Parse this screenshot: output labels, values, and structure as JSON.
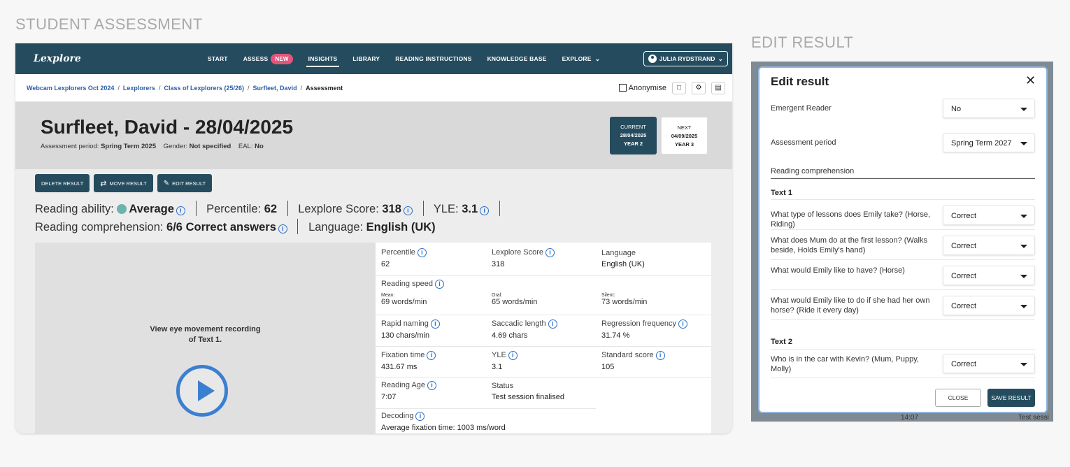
{
  "section_titles": {
    "left": "STUDENT ASSESSMENT",
    "right": "EDIT RESULT"
  },
  "app": {
    "logo": "Lexplore",
    "nav": [
      {
        "label": "START"
      },
      {
        "label": "ASSESS",
        "badge": "NEW"
      },
      {
        "label": "INSIGHTS",
        "active": true
      },
      {
        "label": "LIBRARY"
      },
      {
        "label": "READING INSTRUCTIONS"
      },
      {
        "label": "KNOWLEDGE BASE"
      },
      {
        "label": "EXPLORE"
      }
    ],
    "user": "JULIA RYDSTRAND"
  },
  "breadcrumb": {
    "items": [
      "Webcam Lexplorers Oct 2024",
      "Lexplorers",
      "Class of Lexplorers (25/26)",
      "Surfleet, David"
    ],
    "current": "Assessment",
    "anonymise": "Anonymise"
  },
  "student": {
    "title": "Surfleet, David - 28/04/2025",
    "period_label": "Assessment period:",
    "period": "Spring Term 2025",
    "gender_label": "Gender:",
    "gender": "Not specified",
    "eal_label": "EAL:",
    "eal": "No"
  },
  "periods": {
    "current": {
      "tag": "CURRENT",
      "date": "28/04/2025",
      "year": "YEAR 2"
    },
    "next": {
      "tag": "NEXT",
      "date": "04/09/2025",
      "year": "YEAR 3"
    }
  },
  "actions": {
    "delete": "DELETE RESULT",
    "move": "MOVE RESULT",
    "edit": "EDIT RESULT"
  },
  "summary": {
    "reading_ability_label": "Reading ability:",
    "reading_ability": "Average",
    "percentile_label": "Percentile:",
    "percentile": "62",
    "score_label": "Lexplore Score:",
    "score": "318",
    "yle_label": "YLE:",
    "yle": "3.1",
    "comprehension_label": "Reading comprehension:",
    "comprehension": "6/6 Correct answers",
    "language_label": "Language:",
    "language": "English (UK)"
  },
  "video": {
    "line1": "View eye movement recording",
    "line2": "of Text 1."
  },
  "stats": {
    "percentile": {
      "label": "Percentile",
      "value": "62"
    },
    "lexplore_score": {
      "label": "Lexplore Score",
      "value": "318"
    },
    "language": {
      "label": "Language",
      "value": "English (UK)"
    },
    "reading_speed": {
      "label": "Reading speed",
      "mean_label": "Mean:",
      "mean": "69 words/min",
      "oral_label": "Oral:",
      "oral": "65 words/min",
      "silent_label": "Silent:",
      "silent": "73 words/min"
    },
    "rapid_naming": {
      "label": "Rapid naming",
      "value": "130 chars/min"
    },
    "saccadic_length": {
      "label": "Saccadic length",
      "value": "4.69 chars"
    },
    "regression_frequency": {
      "label": "Regression frequency",
      "value": "31.74 %"
    },
    "fixation_time": {
      "label": "Fixation time",
      "value": "431.67 ms"
    },
    "yle": {
      "label": "YLE",
      "value": "3.1"
    },
    "standard_score": {
      "label": "Standard score",
      "value": "105"
    },
    "reading_age": {
      "label": "Reading Age",
      "value": "7:07"
    },
    "status": {
      "label": "Status",
      "value": "Test session finalised"
    },
    "decoding": {
      "label": "Decoding",
      "value": "Average fixation time: 1003 ms/word"
    }
  },
  "dialog": {
    "title": "Edit result",
    "emergent_label": "Emergent Reader",
    "emergent_value": "No",
    "period_label": "Assessment period",
    "period_value": "Spring Term 2027",
    "comprehension_label": "Reading comprehension",
    "text1": "Text 1",
    "q1": "What type of lessons does Emily take? (Horse, Riding)",
    "q2": "What does Mum do at the first lesson? (Walks beside, Holds Emily's hand)",
    "q3": "What would Emily like to have? (Horse)",
    "q4": "What would Emily like to do if she had her own horse? (Ride it every day)",
    "text2": "Text 2",
    "q5": "Who is in the car with Kevin? (Mum, Puppy, Molly)",
    "answer": "Correct",
    "close": "CLOSE",
    "save": "SAVE RESULT"
  },
  "background_ghost": {
    "time": "14:07",
    "status": "Test sessi"
  },
  "colors": {
    "primary": "#254c5e",
    "link": "#2a5ea8",
    "info": "#2a6fc9",
    "badge": "#e3557b",
    "average_dot": "#6cb3ad"
  }
}
